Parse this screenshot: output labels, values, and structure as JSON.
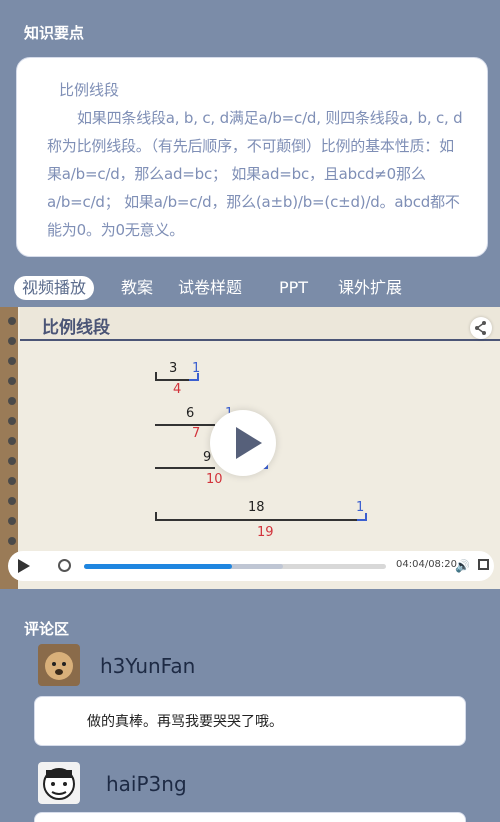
{
  "knowledge": {
    "section_title": "知识要点",
    "heading": "比例线段",
    "body": "如果四条线段a, b, c, d满足a/b=c/d, 则四条线段a, b, c, d称为比例线段。（有先后顺序，不可颠倒）比例的基本性质：如果a/b=c/d，那么ad=bc； 如果ad=bc，且abcd≠0那么a/b=c/d； 如果a/b=c/d，那么(a±b)/b=(c±d)/d。abcd都不能为0。为0无意义。"
  },
  "tabs": [
    {
      "label": "视频播放",
      "active": true
    },
    {
      "label": "教案",
      "active": false
    },
    {
      "label": "试卷样题",
      "active": false
    },
    {
      "label": "PPT",
      "active": false
    },
    {
      "label": "课外扩展",
      "active": false
    }
  ],
  "video": {
    "title": "比例线段",
    "segments": [
      {
        "top": "3",
        "blue": "1",
        "bottom": "4"
      },
      {
        "top": "6",
        "blue": "1",
        "bottom": "7"
      },
      {
        "top": "9",
        "blue": "1",
        "bottom": "10"
      },
      {
        "top": "18",
        "blue": "1",
        "bottom": "19"
      }
    ],
    "time": "04:04/08:20",
    "progress": 0.49,
    "buffered": 0.66
  },
  "comments": {
    "section_title": "评论区",
    "items": [
      {
        "user": "h3YunFan",
        "text": "做的真棒。再骂我要哭哭了哦。"
      },
      {
        "user": "haiP3ng",
        "text": ""
      }
    ]
  },
  "colors": {
    "background": "#7b8ca8",
    "accent_blue": "#1f86e0",
    "knowledge_text": "#7f8fb6",
    "red_label": "#d2333b"
  }
}
